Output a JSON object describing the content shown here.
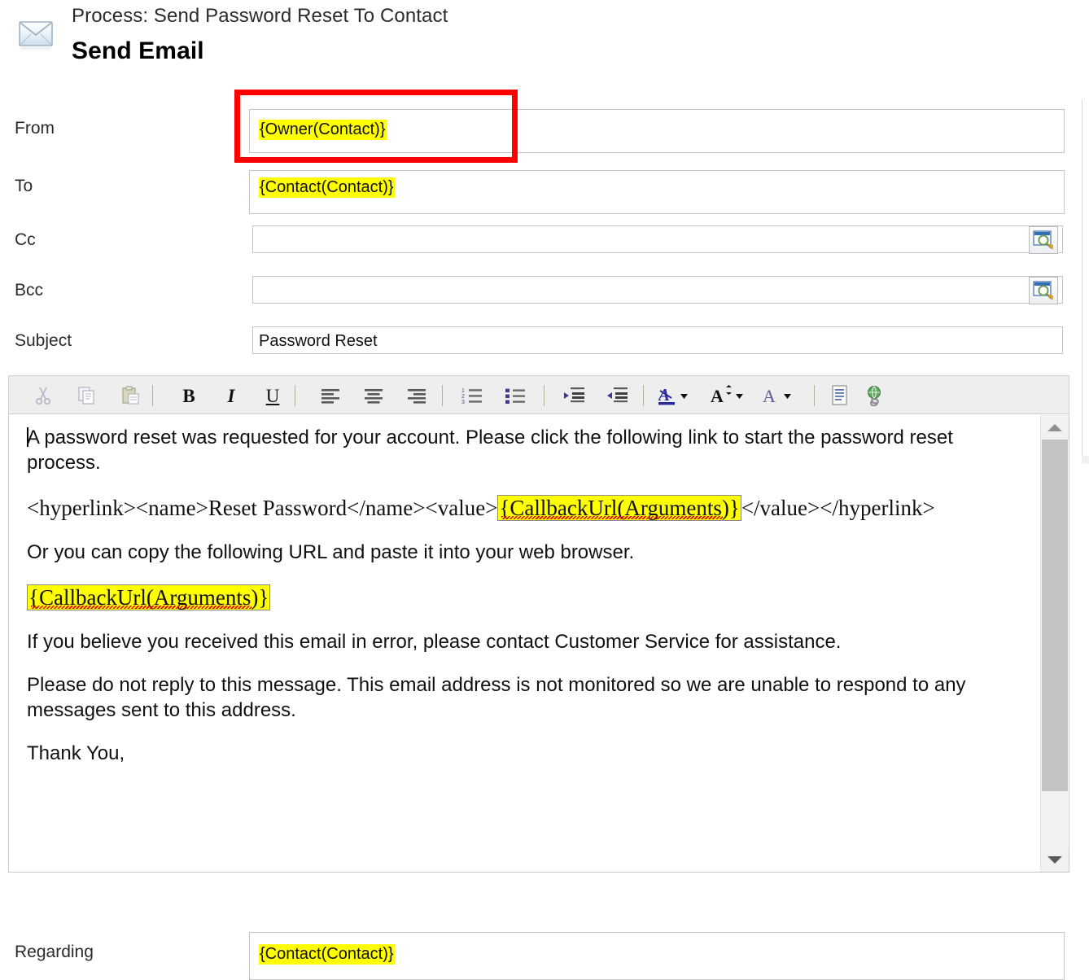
{
  "header": {
    "icon": "envelope-icon",
    "process_label": "Process: Send Password Reset To Contact",
    "title": "Send Email"
  },
  "annotation": {
    "color": "#ff0000",
    "target": "from-field"
  },
  "fields": [
    {
      "key": "from",
      "label": "From",
      "value": "{Owner(Contact)}",
      "highlight": true,
      "lookup": false
    },
    {
      "key": "to",
      "label": "To",
      "value": "{Contact(Contact)}",
      "highlight": true,
      "lookup": false
    },
    {
      "key": "cc",
      "label": "Cc",
      "value": "",
      "highlight": false,
      "lookup": true
    },
    {
      "key": "bcc",
      "label": "Bcc",
      "value": "",
      "highlight": false,
      "lookup": true
    },
    {
      "key": "subject",
      "label": "Subject",
      "value": "Password Reset",
      "highlight": false,
      "lookup": false
    },
    {
      "key": "regarding",
      "label": "Regarding",
      "value": "{Contact(Contact)}",
      "highlight": true,
      "lookup": false
    }
  ],
  "toolbar": {
    "buttons": [
      {
        "name": "cut-icon",
        "tip": "Cut",
        "disabled": true
      },
      {
        "name": "copy-icon",
        "tip": "Copy",
        "disabled": true
      },
      {
        "name": "paste-icon",
        "tip": "Paste",
        "disabled": true
      },
      {
        "name": "bold-icon",
        "tip": "Bold",
        "glyph": "B"
      },
      {
        "name": "italic-icon",
        "tip": "Italic",
        "glyph": "I"
      },
      {
        "name": "underline-icon",
        "tip": "Underline",
        "glyph": "U"
      },
      {
        "name": "align-left-icon",
        "tip": "Align Left"
      },
      {
        "name": "align-center-icon",
        "tip": "Align Center"
      },
      {
        "name": "align-right-icon",
        "tip": "Align Right"
      },
      {
        "name": "numbered-list-icon",
        "tip": "Numbered List"
      },
      {
        "name": "bulleted-list-icon",
        "tip": "Bulleted List"
      },
      {
        "name": "increase-indent-icon",
        "tip": "Increase Indent"
      },
      {
        "name": "decrease-indent-icon",
        "tip": "Decrease Indent"
      },
      {
        "name": "font-color-icon",
        "tip": "Font Color"
      },
      {
        "name": "font-size-icon",
        "tip": "Font Size"
      },
      {
        "name": "font-family-icon",
        "tip": "Font"
      },
      {
        "name": "insert-template-icon",
        "tip": "Insert Template"
      },
      {
        "name": "insert-hyperlink-icon",
        "tip": "Insert Hyperlink"
      }
    ]
  },
  "body": {
    "paragraphs": [
      {
        "style": "sans",
        "text": "A password reset was requested for your account. Please click the following link to start the password reset process."
      },
      {
        "style": "serif",
        "pre": "<hyperlink><name>Reset Password</name><value>",
        "token": "{CallbackUrl(Arguments)}",
        "post": "</value></hyperlink>"
      },
      {
        "style": "sans",
        "text": "Or you can copy the following URL and paste it into your web browser."
      },
      {
        "style": "serif",
        "pre": "",
        "token": "{CallbackUrl(Arguments)}",
        "post": ""
      },
      {
        "style": "sans",
        "text": "If you believe you received this email in error, please contact Customer Service for assistance."
      },
      {
        "style": "sans",
        "text": "Please do not reply to this message. This email address is not monitored so we are unable to respond to any messages sent to this address."
      },
      {
        "style": "sans",
        "text": "Thank You,"
      }
    ]
  },
  "scrollbar": {
    "up_glyph": "scroll-up-arrow",
    "down_glyph": "scroll-down-arrow"
  },
  "colors": {
    "highlight": "#ffff00",
    "annotation": "#ff0000",
    "field_border": "#c4c4c4",
    "toolbar_bg": "#efeeee"
  }
}
